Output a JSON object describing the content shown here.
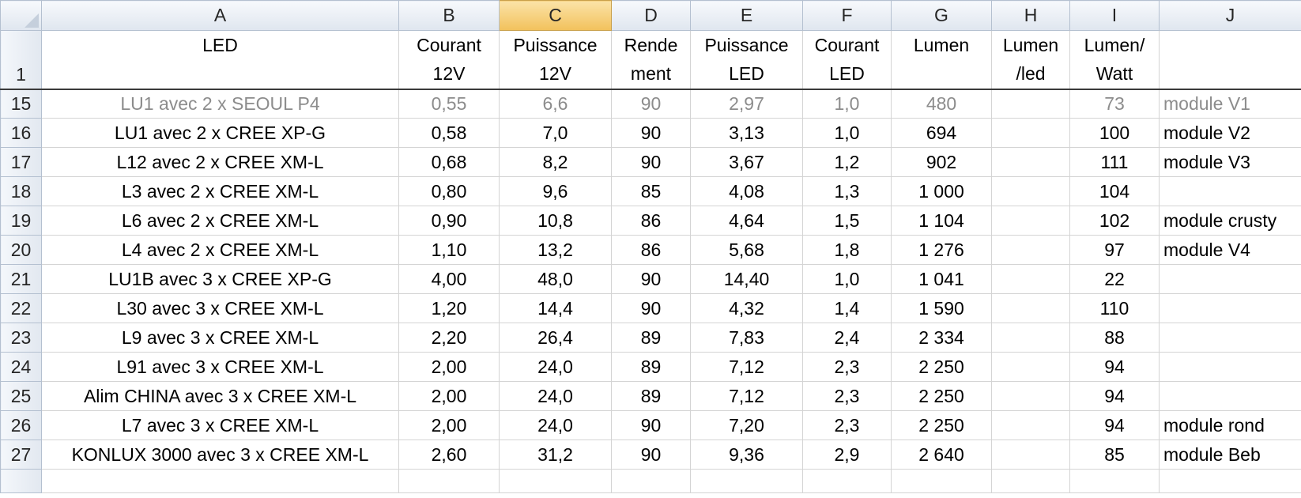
{
  "columns": [
    "A",
    "B",
    "C",
    "D",
    "E",
    "F",
    "G",
    "H",
    "I",
    "J"
  ],
  "selected_column": "C",
  "header_row": {
    "row_number": "1",
    "cells": [
      {
        "line1": "LED",
        "line2": ""
      },
      {
        "line1": "Courant",
        "line2": "12V"
      },
      {
        "line1": "Puissance",
        "line2": "12V"
      },
      {
        "line1": "Rende",
        "line2": "ment"
      },
      {
        "line1": "Puissance",
        "line2": "LED"
      },
      {
        "line1": "Courant",
        "line2": "LED"
      },
      {
        "line1": "Lumen",
        "line2": ""
      },
      {
        "line1": "Lumen",
        "line2": "/led"
      },
      {
        "line1": "Lumen/",
        "line2": "Watt"
      },
      {
        "line1": "",
        "line2": ""
      }
    ]
  },
  "rows": [
    {
      "n": "15",
      "dim": true,
      "cells": [
        "LU1 avec 2 x SEOUL P4",
        "0,55",
        "6,6",
        "90",
        "2,97",
        "1,0",
        "480",
        "",
        "73",
        "module V1"
      ]
    },
    {
      "n": "16",
      "cells": [
        "LU1 avec 2 x CREE XP-G",
        "0,58",
        "7,0",
        "90",
        "3,13",
        "1,0",
        "694",
        "",
        "100",
        "module V2"
      ]
    },
    {
      "n": "17",
      "cells": [
        "L12 avec 2 x CREE XM-L",
        "0,68",
        "8,2",
        "90",
        "3,67",
        "1,2",
        "902",
        "",
        "111",
        "module V3"
      ]
    },
    {
      "n": "18",
      "cells": [
        "L3 avec 2 x CREE XM-L",
        "0,80",
        "9,6",
        "85",
        "4,08",
        "1,3",
        "1 000",
        "",
        "104",
        ""
      ]
    },
    {
      "n": "19",
      "cells": [
        "L6 avec 2 x CREE XM-L",
        "0,90",
        "10,8",
        "86",
        "4,64",
        "1,5",
        "1 104",
        "",
        "102",
        "module crusty"
      ]
    },
    {
      "n": "20",
      "cells": [
        "L4 avec 2 x CREE XM-L",
        "1,10",
        "13,2",
        "86",
        "5,68",
        "1,8",
        "1 276",
        "",
        "97",
        "module V4"
      ]
    },
    {
      "n": "21",
      "cells": [
        "LU1B avec 3 x CREE XP-G",
        "4,00",
        "48,0",
        "90",
        "14,40",
        "1,0",
        "1 041",
        "",
        "22",
        ""
      ]
    },
    {
      "n": "22",
      "cells": [
        "L30 avec 3 x CREE XM-L",
        "1,20",
        "14,4",
        "90",
        "4,32",
        "1,4",
        "1 590",
        "",
        "110",
        ""
      ]
    },
    {
      "n": "23",
      "cells": [
        "L9 avec 3 x CREE XM-L",
        "2,20",
        "26,4",
        "89",
        "7,83",
        "2,4",
        "2 334",
        "",
        "88",
        ""
      ]
    },
    {
      "n": "24",
      "cells": [
        "L91 avec 3 x CREE XM-L",
        "2,00",
        "24,0",
        "89",
        "7,12",
        "2,3",
        "2 250",
        "",
        "94",
        ""
      ]
    },
    {
      "n": "25",
      "cells": [
        "Alim CHINA avec 3 x CREE XM-L",
        "2,00",
        "24,0",
        "89",
        "7,12",
        "2,3",
        "2 250",
        "",
        "94",
        ""
      ]
    },
    {
      "n": "26",
      "cells": [
        "L7 avec 3 x CREE XM-L",
        "2,00",
        "24,0",
        "90",
        "7,20",
        "2,3",
        "2 250",
        "",
        "94",
        "module rond"
      ]
    },
    {
      "n": "27",
      "cells": [
        "KONLUX 3000 avec 3 x CREE XM-L",
        "2,60",
        "31,2",
        "90",
        "9,36",
        "2,9",
        "2 640",
        "",
        "85",
        "module Beb"
      ]
    }
  ],
  "colors": {
    "selected_header": "#f2c15c",
    "header_bg": "#dfe6ef",
    "dim_text": "#8c8c8c",
    "gridline": "#d4d4d4"
  },
  "icons": {
    "corner": "select-all-triangle-icon"
  }
}
